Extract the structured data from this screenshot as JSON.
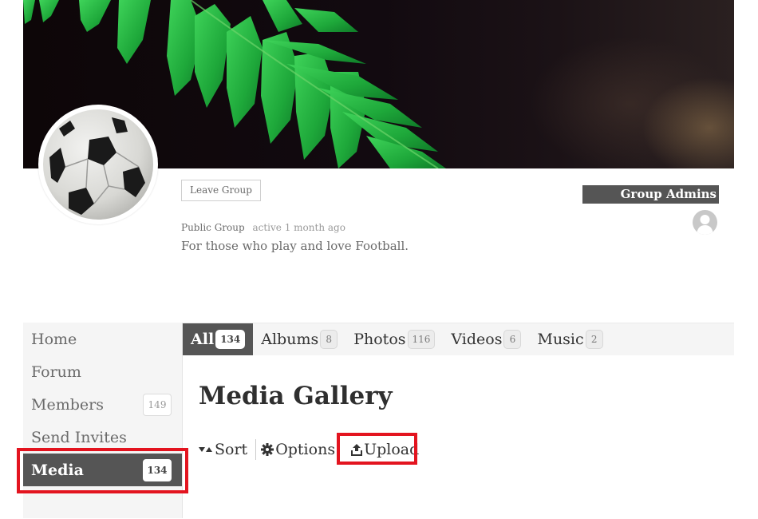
{
  "cover": {
    "image": "fern-leaves-cover-photo"
  },
  "group": {
    "avatar": "soccer-ball-avatar",
    "leave_label": "Leave Group",
    "type": "Public Group",
    "activity": "active 1 month ago",
    "description": "For those who play and love Football."
  },
  "admins": {
    "title": "Group Admins"
  },
  "nav": {
    "items": [
      {
        "label": "Home",
        "count": null
      },
      {
        "label": "Forum",
        "count": null
      },
      {
        "label": "Members",
        "count": "149"
      },
      {
        "label": "Send Invites",
        "count": null
      },
      {
        "label": "Media",
        "count": "134",
        "selected": true
      }
    ]
  },
  "tabs": [
    {
      "label": "All",
      "count": "134",
      "selected": true
    },
    {
      "label": "Albums",
      "count": "8"
    },
    {
      "label": "Photos",
      "count": "116"
    },
    {
      "label": "Videos",
      "count": "6"
    },
    {
      "label": "Music",
      "count": "2"
    }
  ],
  "main": {
    "title": "Media Gallery",
    "toolbar": {
      "sort": "Sort",
      "options": "Options",
      "upload": "Upload"
    }
  },
  "colors": {
    "highlight": "#e3141f",
    "selected_bg": "#555555",
    "nav_bg": "#f5f5f5"
  }
}
